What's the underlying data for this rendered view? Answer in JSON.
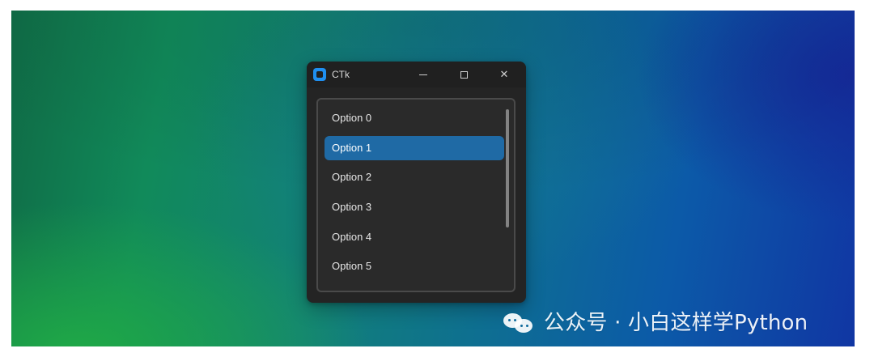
{
  "window": {
    "title": "CTk",
    "buttons": {
      "minimize_icon": "minimize-icon",
      "maximize_icon": "maximize-icon",
      "close_icon": "close-icon"
    }
  },
  "list": {
    "options": [
      {
        "label": "Option 0"
      },
      {
        "label": "Option 1",
        "selected": true
      },
      {
        "label": "Option 2"
      },
      {
        "label": "Option 3"
      },
      {
        "label": "Option 4"
      },
      {
        "label": "Option 5"
      }
    ]
  },
  "watermark": {
    "text": "公众号 · 小白这样学Python",
    "icon": "wechat-icon"
  },
  "colors": {
    "window_bg": "#242424",
    "selection_blue": "#1f6aa5",
    "app_icon_blue": "#1f8ff0"
  }
}
